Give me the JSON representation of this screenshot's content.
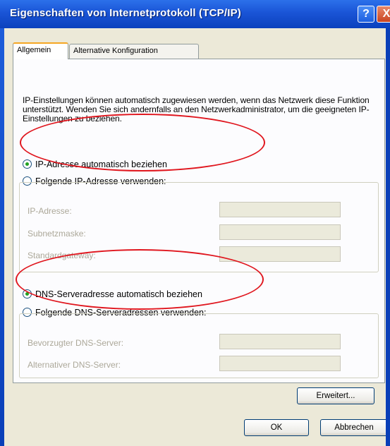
{
  "window": {
    "title": "Eigenschaften von Internetprotokoll (TCP/IP)",
    "help_label": "?",
    "close_label": "X"
  },
  "tabs": [
    {
      "label": "Allgemein",
      "selected": true
    },
    {
      "label": "Alternative Konfiguration",
      "selected": false
    }
  ],
  "intro_text": "IP-Einstellungen können automatisch zugewiesen werden, wenn das Netzwerk diese Funktion unterstützt. Wenden Sie sich andernfalls an den Netzwerkadministrator, um die geeigneten IP-Einstellungen zu beziehen.",
  "ip": {
    "auto_label": "IP-Adresse automatisch beziehen",
    "manual_label": "Folgende IP-Adresse verwenden:",
    "selected": "auto",
    "fields": [
      {
        "label": "IP-Adresse:",
        "value": ""
      },
      {
        "label": "Subnetzmaske:",
        "value": ""
      },
      {
        "label": "Standardgateway:",
        "value": ""
      }
    ]
  },
  "dns": {
    "auto_label": "DNS-Serveradresse automatisch beziehen",
    "manual_label": "Folgende DNS-Serveradressen verwenden:",
    "selected": "auto",
    "fields": [
      {
        "label": "Bevorzugter DNS-Server:",
        "value": ""
      },
      {
        "label": "Alternativer DNS-Server:",
        "value": ""
      }
    ]
  },
  "buttons": {
    "advanced": "Erweitert...",
    "ok": "OK",
    "cancel": "Abbrechen"
  },
  "colors": {
    "title_bar": "#1a54d6",
    "dialog_bg": "#ece9d8",
    "highlight_oval": "#e0161e",
    "radio_dot": "#21a121"
  }
}
